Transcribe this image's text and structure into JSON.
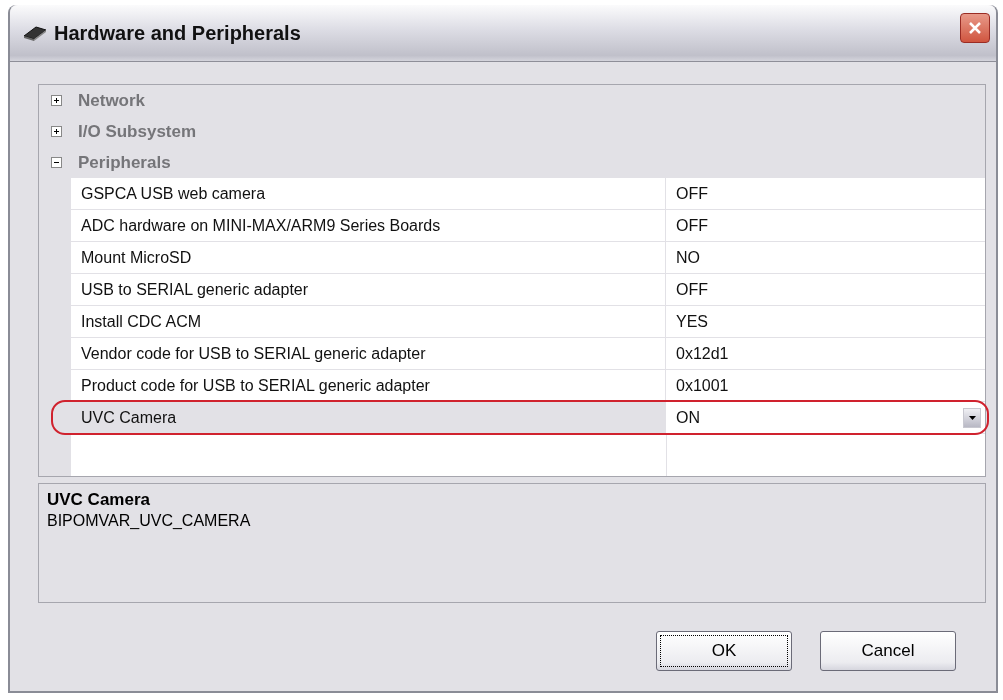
{
  "window": {
    "title": "Hardware and Peripherals"
  },
  "categories": [
    {
      "label": "Network",
      "expanded": false
    },
    {
      "label": "I/O Subsystem",
      "expanded": false
    },
    {
      "label": "Peripherals",
      "expanded": true,
      "properties": [
        {
          "name": "GSPCA USB web camera",
          "value": "OFF",
          "selected": false
        },
        {
          "name": "ADC hardware on MINI-MAX/ARM9 Series Boards",
          "value": "OFF",
          "selected": false
        },
        {
          "name": "Mount MicroSD",
          "value": "NO",
          "selected": false
        },
        {
          "name": "USB to SERIAL generic adapter",
          "value": "OFF",
          "selected": false
        },
        {
          "name": "Install CDC ACM",
          "value": "YES",
          "selected": false
        },
        {
          "name": "Vendor code for USB to SERIAL generic adapter",
          "value": "0x12d1",
          "selected": false
        },
        {
          "name": "Product code for USB to SERIAL generic adapter",
          "value": "0x1001",
          "selected": false
        },
        {
          "name": "UVC Camera",
          "value": "ON",
          "selected": true
        }
      ]
    }
  ],
  "description": {
    "title": "UVC Camera",
    "text": "BIPOMVAR_UVC_CAMERA"
  },
  "buttons": [
    {
      "label": "OK",
      "default": true
    },
    {
      "label": "Cancel",
      "default": false
    }
  ]
}
